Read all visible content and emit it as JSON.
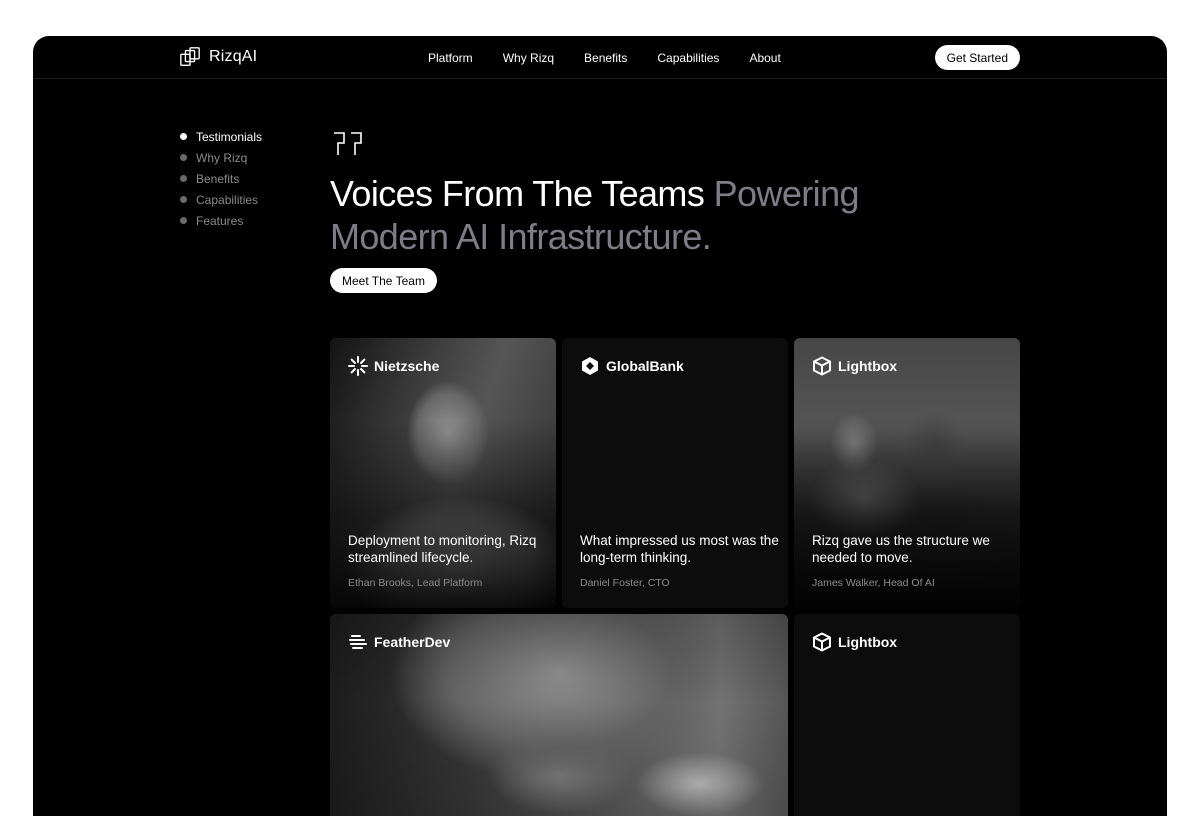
{
  "nav": {
    "logo_text": "RizqAI",
    "links": [
      "Platform",
      "Why Rizq",
      "Benefits",
      "Capabilities",
      "About"
    ],
    "cta": "Get Started"
  },
  "side_nav": {
    "items": [
      "Testimonials",
      "Why Rizq",
      "Benefits",
      "Capabilities",
      "Features"
    ],
    "active_index": 0
  },
  "hero": {
    "heading_light": "Voices From The Teams",
    "heading_muted": "Powering Modern AI Infrastructure.",
    "button": "Meet The Team"
  },
  "testimonials": [
    {
      "company": "Nietzsche",
      "icon": "sunburst-icon",
      "quote": "Deployment to monitoring, Rizq streamlined lifecycle.",
      "author": "Ethan Brooks, Lead Platform"
    },
    {
      "company": "GlobalBank",
      "icon": "hexagon-icon",
      "quote": "What impressed us most was the long-term thinking.",
      "author": "Daniel Foster, CTO"
    },
    {
      "company": "Lightbox",
      "icon": "cube-icon",
      "quote": "Rizq gave us the structure we needed to move.",
      "author": "James Walker, Head Of AI"
    },
    {
      "company": "FeatherDev",
      "icon": "feather-stripes-icon"
    },
    {
      "company": "Lightbox",
      "icon": "cube-icon"
    }
  ],
  "colors": {
    "background": "#000000",
    "muted_heading": "#7d7d86",
    "accent_button": "#ffffff"
  }
}
